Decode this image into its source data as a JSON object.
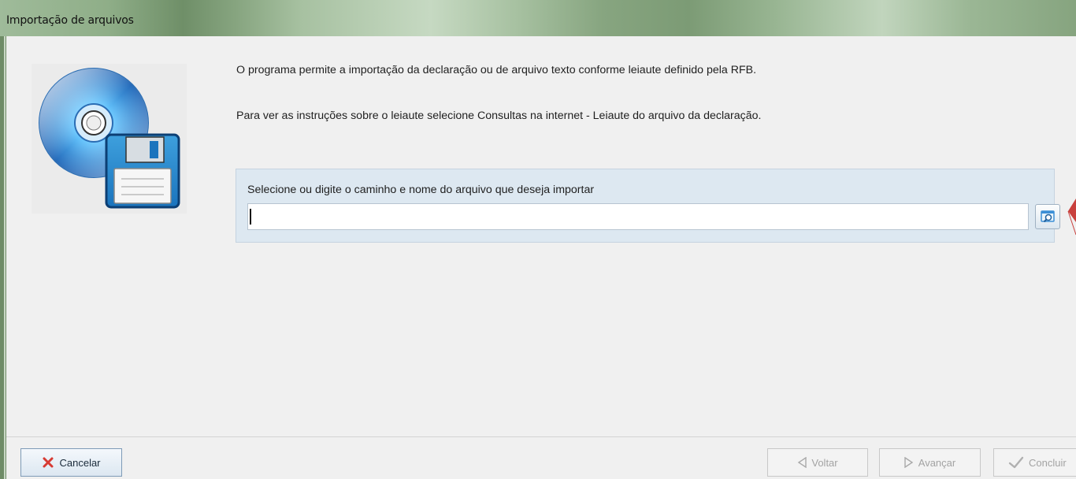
{
  "window": {
    "title": "Importação de arquivos"
  },
  "content": {
    "intro_text_1": "O programa permite a importação da declaração ou de arquivo texto conforme leiaute definido pela RFB.",
    "intro_text_2": "Para ver as instruções sobre o leiaute selecione Consultas na internet - Leiaute do arquivo da declaração.",
    "file_selector": {
      "label": "Selecione ou digite o caminho e nome do arquivo que deseja importar",
      "value": "",
      "browse_icon": "magnifier-window-icon"
    }
  },
  "footer": {
    "cancel_label": "Cancelar",
    "back_label": "Voltar",
    "next_label": "Avançar",
    "finish_label": "Concluir",
    "cancel_icon": "red-x-icon",
    "back_icon": "triangle-left-icon",
    "next_icon": "triangle-right-icon",
    "finish_icon": "checkmark-icon"
  },
  "icons": {
    "hero": "cd-floppy-icon"
  },
  "colors": {
    "titlebar_green": "#8fae88",
    "panel_blue": "#dde8f1",
    "accent_blue": "#3c8fd6",
    "disabled_text": "#a3a3a3"
  }
}
